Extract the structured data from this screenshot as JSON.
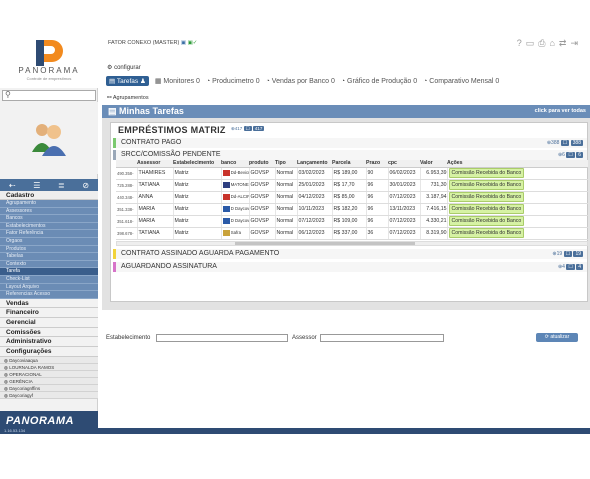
{
  "brand": {
    "name": "PANORAMA",
    "tagline": "Controle de emprestimos",
    "footer_name": "PANORAMA",
    "version": "1.16.53.134"
  },
  "topbar": {
    "title": "FATOR CONEXO (MASTER)"
  },
  "config_link": "configurar",
  "tabs": {
    "active": "Tarefas",
    "items": [
      "Monitores 0",
      "Producimetro 0",
      "Vendas por Banco 0",
      "Gráfico de Produção 0",
      "Comparativo Mensal 0"
    ]
  },
  "breadcrumb": "Agrupamentos",
  "panel": {
    "title": "Minhas Tarefas",
    "hint": "click para ver todas"
  },
  "sidebar": {
    "cadastro_label": "Cadastro",
    "cadastro_items": [
      "Agrupamento",
      "Assessores",
      "Bancos",
      "Estabelecimentos",
      "Fator Referência",
      "Orgaos",
      "Produtos",
      "Tabelas",
      "Contexto",
      "Tarefa",
      "Check-List",
      "Layout Arquivo",
      "Referencias Acesso"
    ],
    "active_item": "Tarefa",
    "sections": [
      "Vendas",
      "Financeiro",
      "Gerencial",
      "Comissões",
      "Administrativo",
      "Configurações"
    ],
    "small_items": [
      "Daycoviaaqua",
      "LOURNALDA RAMOS",
      "OPERACIONAL",
      "GERÊNCIA",
      "Daycoriagnffins",
      "Daycoriagyf"
    ]
  },
  "emprestimos": {
    "title": "EMPRÉSTIMOS MATRIZ",
    "badge": "417",
    "badge_label": "417",
    "rows": {
      "pago": {
        "label": "CONTRATO PAGO",
        "count": "388",
        "count_badge": "388"
      },
      "srcc": {
        "label": "SRCC/COMISSÃO PENDENTE",
        "count": "6",
        "count_badge": "6"
      },
      "aguarda": {
        "label": "CONTRATO ASSINADO AGUARDA PAGAMENTO",
        "count": "19",
        "count_badge": "19"
      },
      "assin": {
        "label": "AGUARDANDO ASSINATURA",
        "count": "4",
        "count_badge": "4"
      }
    }
  },
  "table": {
    "headers": [
      "",
      "Assessor",
      "Estabelecimento",
      "banco",
      "produto",
      "Tipo",
      "Lançamento",
      "Parcela",
      "Prazo",
      "cpc",
      "Valor",
      "Ações"
    ],
    "rows": [
      {
        "id": "490.358-",
        "assessor": "THAMIRES",
        "estab": "Matriz",
        "banco": "Dd-Bevicred",
        "produto": "GOVSP",
        "tipo": "Normal",
        "lanc": "03/02/2023",
        "parcela": "R$ 189,00",
        "prazo": "90",
        "cpc": "06/02/2023",
        "valor": "6.953,39",
        "acao": "Comissão Recebida do Banco"
      },
      {
        "id": "725.288-",
        "assessor": "TATIANA",
        "estab": "Matriz",
        "banco": "MATONE",
        "produto": "GOVSP",
        "tipo": "Normal",
        "lanc": "25/01/2023",
        "parcela": "R$ 17,70",
        "prazo": "96",
        "cpc": "30/01/2023",
        "valor": "731,30",
        "acao": "Comissão Recebida do Banco"
      },
      {
        "id": "440.348-",
        "assessor": "ANNA",
        "estab": "Matriz",
        "banco": "Dd-ALCIF",
        "produto": "GOVSP",
        "tipo": "Normal",
        "lanc": "04/12/2023",
        "parcela": "R$ 85,00",
        "prazo": "96",
        "cpc": "07/12/2023",
        "valor": "3.187,94",
        "acao": "Comissão Recebida do Banco"
      },
      {
        "id": "351.338-",
        "assessor": "MARIA",
        "estab": "Matriz",
        "banco": "D Daycoval",
        "produto": "GOVSP",
        "tipo": "Normal",
        "lanc": "10/11/2023",
        "parcela": "R$ 182,20",
        "prazo": "96",
        "cpc": "13/11/2023",
        "valor": "7.416,15",
        "acao": "Comissão Recebida do Banco"
      },
      {
        "id": "351.618-",
        "assessor": "MARIA",
        "estab": "Matriz",
        "banco": "D Daycoval",
        "produto": "GOVSP",
        "tipo": "Normal",
        "lanc": "07/12/2023",
        "parcela": "R$ 109,00",
        "prazo": "96",
        "cpc": "07/12/2023",
        "valor": "4.330,21",
        "acao": "Comissão Recebida do Banco"
      },
      {
        "id": "398.678-",
        "assessor": "TATIANA",
        "estab": "Matriz",
        "banco": "Safra",
        "produto": "GOVSP",
        "tipo": "Normal",
        "lanc": "06/12/2023",
        "parcela": "R$ 337,00",
        "prazo": "36",
        "cpc": "07/12/2023",
        "valor": "8.319,90",
        "acao": "Comissão Recebida do Banco"
      }
    ]
  },
  "filters": {
    "estab_label": "Estabelecimento",
    "assessor_label": "Assessor",
    "button": "atualizar"
  },
  "colors": {
    "primary": "#2f5f93",
    "panel_head": "#6a8db8",
    "action_green": "#d6f2a4"
  }
}
